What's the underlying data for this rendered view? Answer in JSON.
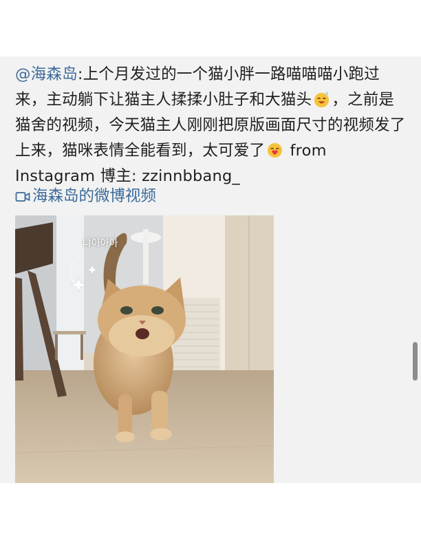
{
  "post": {
    "mention": "@海森岛",
    "text_1": ":上个月发过的一个猫小胖一路喵喵喵小跑过来，主动躺下让猫主人揉揉小肚子和大猫头",
    "text_2": "，之前是猫舍的视频，今天猫主人刚刚把原版画面尺寸的视频发了上来，猫咪表情全能看到，太可爱了",
    "text_3": " from Instagram 博主: zzinnbbang_",
    "emoji_1": "sweat-smile-emoji",
    "emoji_2": "heart-kiss-emoji"
  },
  "video_link": {
    "label": "海森岛的微博视频",
    "icon": "video-camera-icon"
  },
  "media": {
    "sticker_text": "냐아아아",
    "description_icon": "cat-video-thumbnail"
  },
  "colors": {
    "link": "#3c6a9a",
    "text": "#1f1f1f",
    "card_bg": "#f2f2f2"
  }
}
